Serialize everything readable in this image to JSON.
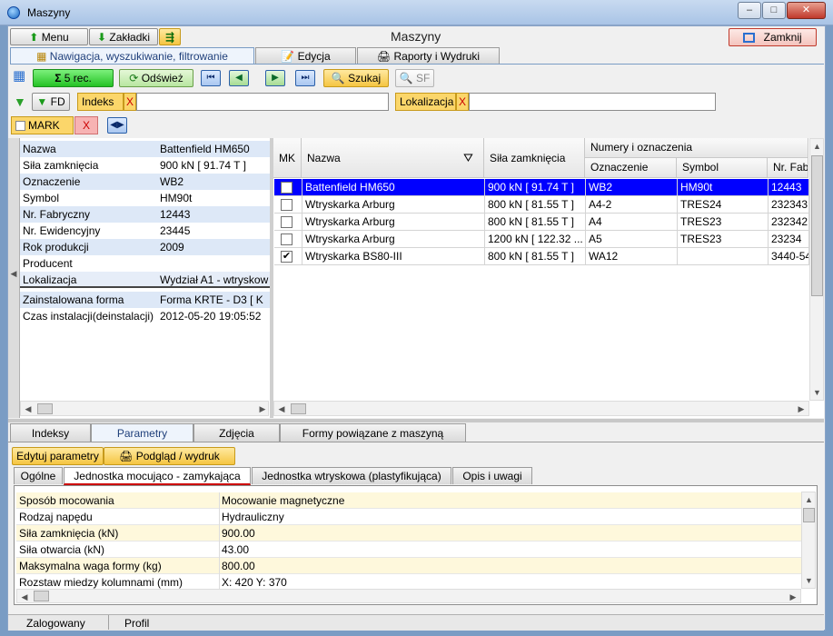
{
  "window": {
    "title": "Maszyny",
    "min": "‒",
    "max": "□",
    "close": "✕"
  },
  "toolbar": {
    "menu": "Menu",
    "zakladki": "Zakładki",
    "window_title": "Maszyny",
    "zamknij": "Zamknij"
  },
  "main_tabs": [
    "Nawigacja, wyszukiwanie, filtrowanie",
    "Edycja",
    "Raporty i Wydruki"
  ],
  "nav": {
    "rec": "5 rec.",
    "odswiez": "Odśwież",
    "szukaj": "Szukaj",
    "sf": "SF",
    "first": "⏮",
    "prev": "◀",
    "next": "▶",
    "last": "⏭"
  },
  "filter": {
    "fd": "FD",
    "indeks": "Indeks",
    "x": "X",
    "lokalizacja": "Lokalizacja",
    "mark": "MARK"
  },
  "details": [
    {
      "k": "Nazwa",
      "v": "Battenfield HM650"
    },
    {
      "k": "Siła zamknięcia",
      "v": "900 kN [ 91.74 T ]"
    },
    {
      "k": "Oznaczenie",
      "v": "WB2"
    },
    {
      "k": "Symbol",
      "v": "HM90t"
    },
    {
      "k": "Nr. Fabryczny",
      "v": "12443"
    },
    {
      "k": "Nr. Ewidencyjny",
      "v": "23445"
    },
    {
      "k": "Rok produkcji",
      "v": "2009"
    },
    {
      "k": "Producent",
      "v": ""
    },
    {
      "k": "Lokalizacja",
      "v": "Wydział A1 - wtryskow"
    },
    {
      "k": "Zainstalowana forma",
      "v": "Forma  KRTE - D3 [ K"
    },
    {
      "k": "Czas instalacji(deinstalacji)",
      "v": "2012-05-20  19:05:52"
    }
  ],
  "grid": {
    "headers": {
      "mk": "MK",
      "nazwa": "Nazwa",
      "sila": "Siła zamknięcia",
      "group": "Numery i oznaczenia",
      "ozn": "Oznaczenie",
      "symbol": "Symbol",
      "nrfab": "Nr. Fab"
    },
    "rows": [
      {
        "mk": false,
        "nazwa": "Battenfield HM650",
        "sila": "900 kN [ 91.74 T ]",
        "ozn": "WB2",
        "symbol": "HM90t",
        "nrfab": "12443"
      },
      {
        "mk": false,
        "nazwa": "Wtryskarka Arburg",
        "sila": "800 kN [ 81.55 T ]",
        "ozn": "A4-2",
        "symbol": "TRES24",
        "nrfab": "232343"
      },
      {
        "mk": false,
        "nazwa": "Wtryskarka Arburg",
        "sila": "800 kN [ 81.55 T ]",
        "ozn": "A4",
        "symbol": "TRES23",
        "nrfab": "232342"
      },
      {
        "mk": false,
        "nazwa": "Wtryskarka Arburg",
        "sila": "1200 kN [ 122.32 ...",
        "ozn": "A5",
        "symbol": "TRES23",
        "nrfab": "23234"
      },
      {
        "mk": true,
        "nazwa": "Wtryskarka BS80-III",
        "sila": "800 kN [ 81.55 T ]",
        "ozn": "WA12",
        "symbol": "",
        "nrfab": "3440-54"
      }
    ]
  },
  "bottom_tabs": [
    "Indeksy",
    "Parametry",
    "Zdjęcia",
    "Formy powiązane z maszyną"
  ],
  "bottom_buttons": {
    "edytuj": "Edytuj parametry",
    "podglad": "Podgląd / wydruk"
  },
  "sub_tabs": [
    "Ogólne",
    "Jednostka mocująco - zamykająca",
    "Jednostka wtryskowa (plastyfikująca)",
    "Opis i uwagi"
  ],
  "params": [
    {
      "k": "Sposób mocowania",
      "v": "Mocowanie magnetyczne"
    },
    {
      "k": "Rodzaj napędu",
      "v": "Hydrauliczny"
    },
    {
      "k": "Siła zamknięcia (kN)",
      "v": "900.00"
    },
    {
      "k": "Siła otwarcia (kN)",
      "v": "43.00"
    },
    {
      "k": "Maksymalna waga formy (kg)",
      "v": "800.00"
    },
    {
      "k": "Rozstaw miedzy kolumnami  (mm)",
      "v": "X: 420     Y: 370"
    }
  ],
  "status": {
    "zalogowany": "Zalogowany",
    "profil": "Profil"
  }
}
